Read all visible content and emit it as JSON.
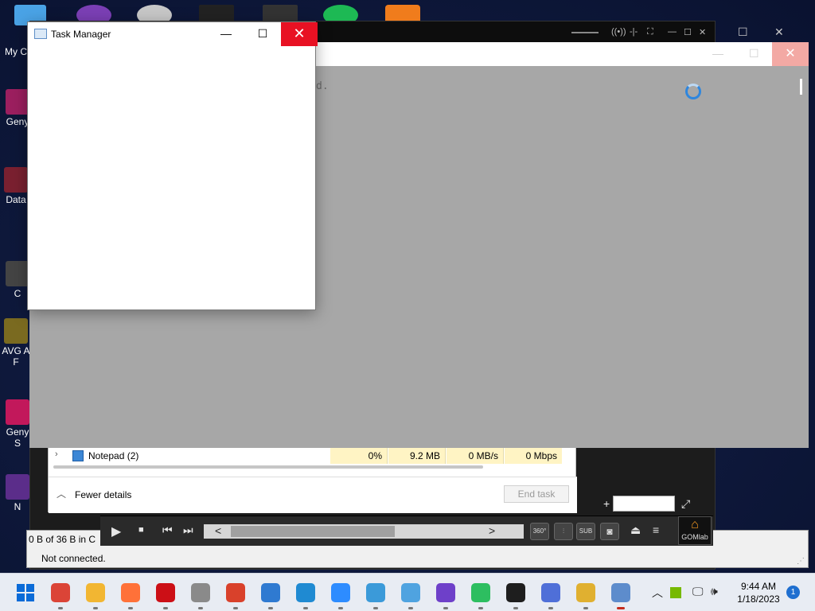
{
  "desktop": {
    "icons": [
      {
        "label": "My C",
        "top": "my-c"
      },
      {
        "label": "Geny",
        "id": "geny"
      },
      {
        "label": "Data",
        "id": "data"
      },
      {
        "label": "C",
        "id": "c"
      },
      {
        "label": "AVG A",
        "id": "avg"
      },
      {
        "label": "F",
        "id": "f"
      },
      {
        "label": "Geny",
        "id": "geny2"
      },
      {
        "label": "S",
        "id": "s"
      },
      {
        "label": "N",
        "id": "n"
      }
    ]
  },
  "gray_window": {
    "text": "d."
  },
  "task_manager_small": {
    "title": "Task Manager",
    "minimize": "—",
    "maximize": "☐",
    "close": "✕"
  },
  "task_manager_full": {
    "row": {
      "name": "Notepad (2)",
      "cpu": "0%",
      "memory": "9.2 MB",
      "disk": "0 MB/s",
      "network": "0 Mbps"
    },
    "fewer_details": "Fewer details",
    "end_task": "End task"
  },
  "status_window": {
    "line1": "0 B of 36 B in C",
    "line2": "Not connected.",
    "left_char": "0",
    "left_char2": "N"
  },
  "gom": {
    "btn_360": "360°",
    "btn_sub": "SUB",
    "logo": "GOMlab"
  },
  "taskbar": {
    "time": "9:44 AM",
    "date": "1/18/2023",
    "notification_count": "1",
    "apps": [
      {
        "name": "chrome-icon",
        "color": "#db4437"
      },
      {
        "name": "file-explorer-icon",
        "color": "#f2b632"
      },
      {
        "name": "firefox-icon",
        "color": "#ff7139"
      },
      {
        "name": "opera-icon",
        "color": "#cc0f16"
      },
      {
        "name": "clock-icon",
        "color": "#8a8a8a"
      },
      {
        "name": "ccleaner-icon",
        "color": "#d9412b"
      },
      {
        "name": "thunderbird-icon",
        "color": "#2f7ad1"
      },
      {
        "name": "vscode-icon",
        "color": "#1f8ad2"
      },
      {
        "name": "zoom-icon",
        "color": "#2d8cff"
      },
      {
        "name": "maps-icon",
        "color": "#3b9ad9"
      },
      {
        "name": "notepad-icon",
        "color": "#4fa3e0"
      },
      {
        "name": "github-icon",
        "color": "#6e40c9"
      },
      {
        "name": "evernote-icon",
        "color": "#2dbe60"
      },
      {
        "name": "terminal-icon",
        "color": "#1e1e1e"
      },
      {
        "name": "crystal-icon",
        "color": "#4f6fd8"
      },
      {
        "name": "archive-icon",
        "color": "#e0b030"
      },
      {
        "name": "task-manager-icon",
        "color": "#5d8ccc"
      }
    ]
  }
}
